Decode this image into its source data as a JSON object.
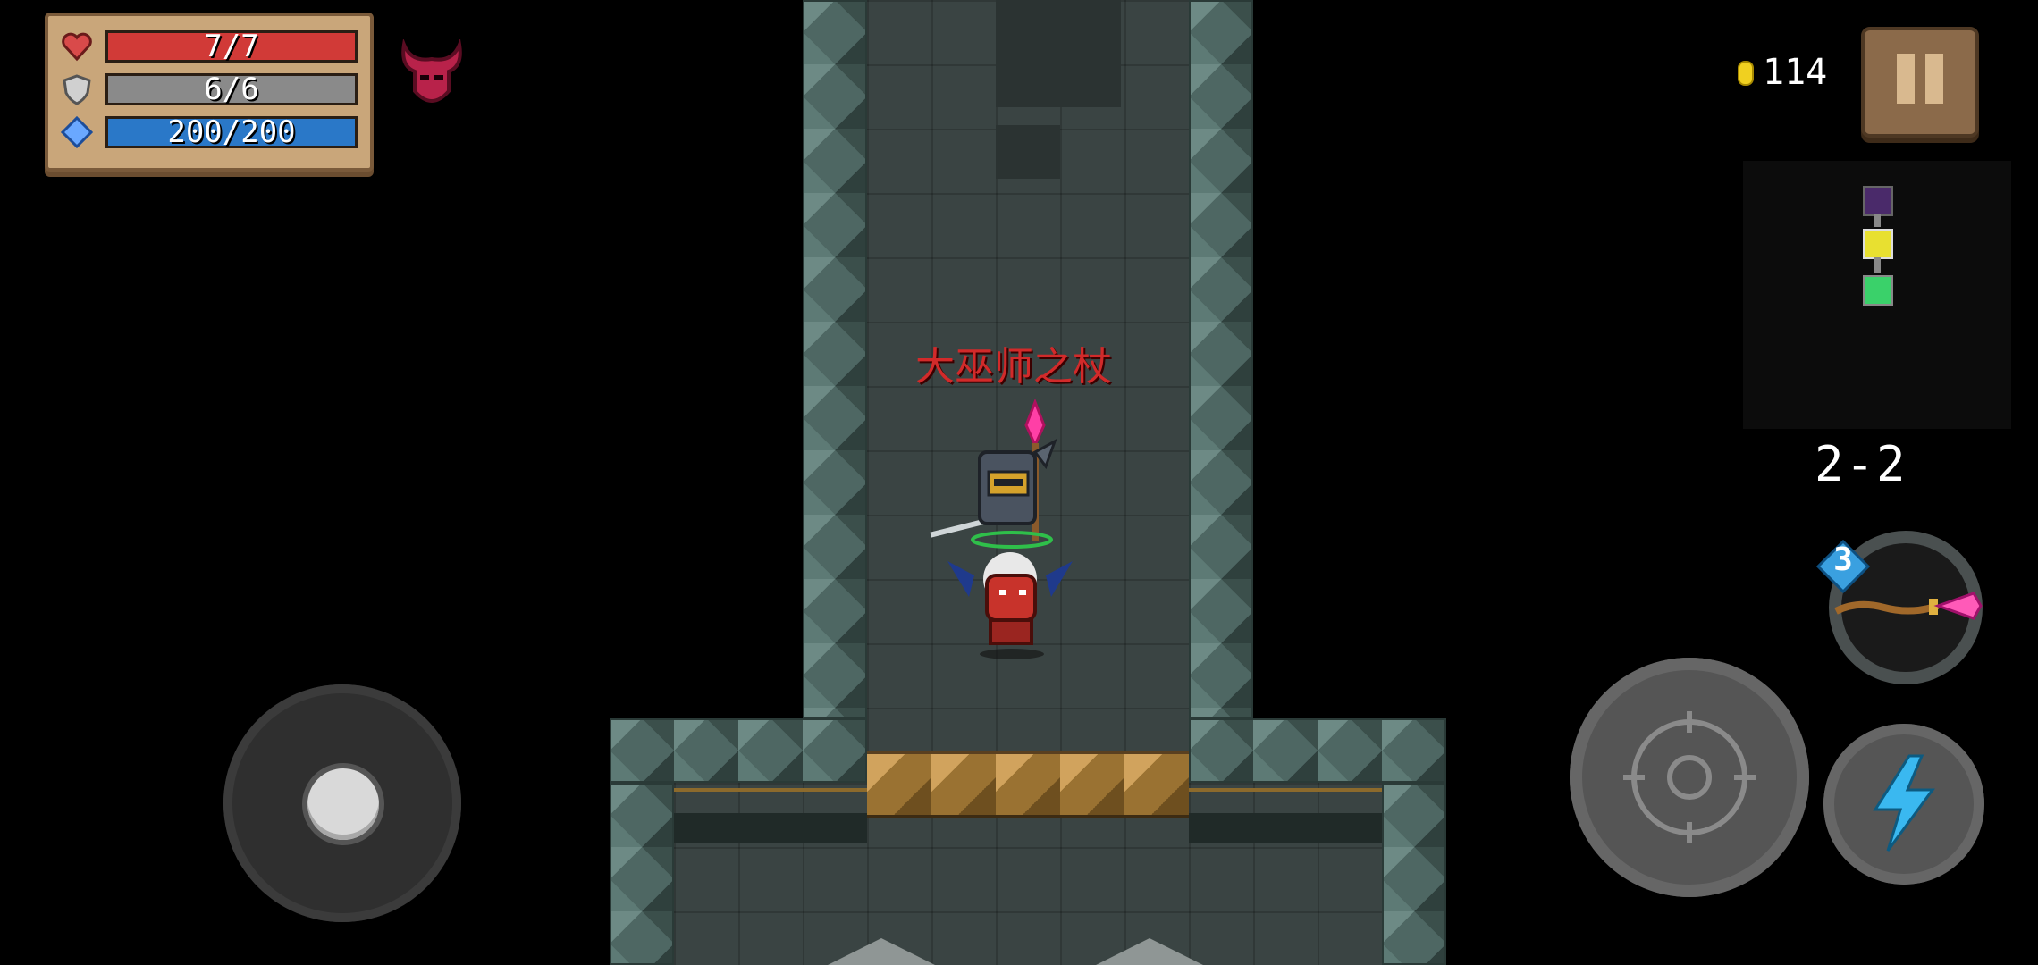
{
  "hud": {
    "health": "7/7",
    "armor": "6/6",
    "energy": "200/200",
    "coins": "114",
    "level": "2-2",
    "weapon_energy_cost": "3",
    "buff_icon": "demon-helmet-icon"
  },
  "world": {
    "item_label": "大巫师之杖"
  },
  "controls": {
    "pause_icon": "pause-icon",
    "joystick_icon": "joystick-icon",
    "fire_icon": "crosshair-icon",
    "skill_icon": "lightning-icon",
    "weapon_icon": "archmage-staff-icon"
  },
  "colors": {
    "hp": "#d13a37",
    "armor": "#8a8a8a",
    "energy": "#2a78c8",
    "item_label": "#d22a2a",
    "coin": "#f0d020",
    "skill": "#3ab8f0"
  }
}
